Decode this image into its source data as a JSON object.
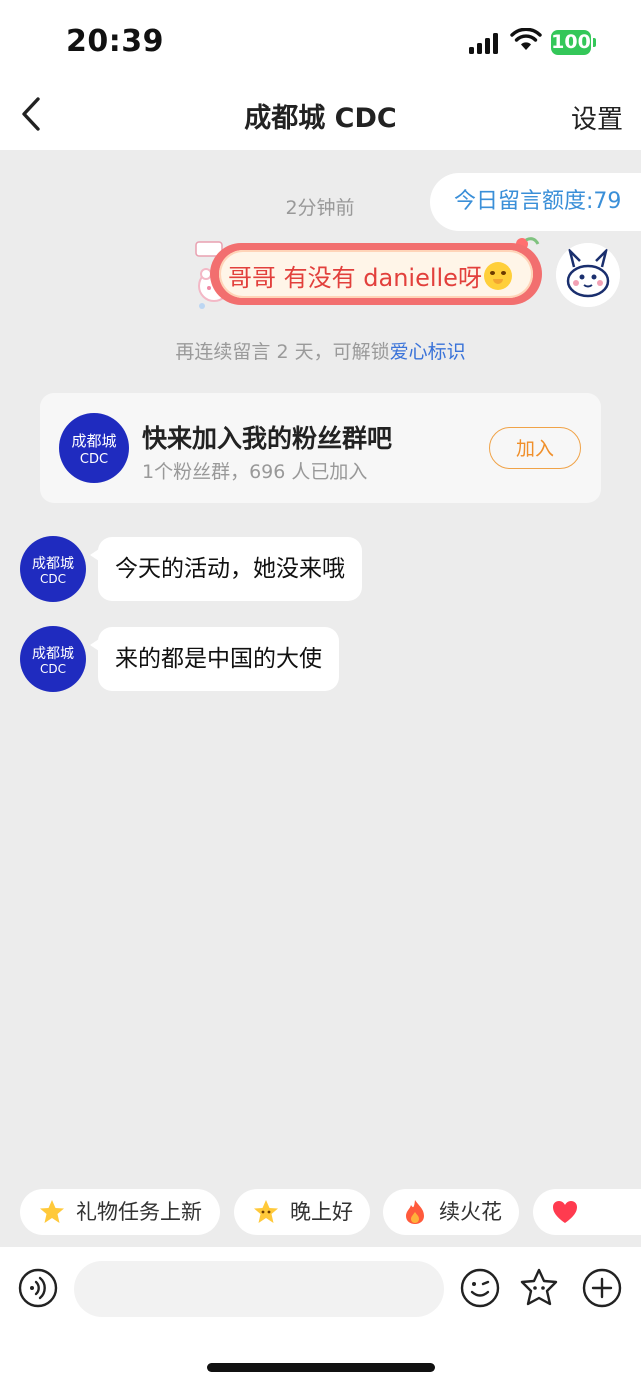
{
  "status_bar": {
    "time": "20:39",
    "battery": "100"
  },
  "nav": {
    "title": "成都城 CDC",
    "settings_label": "设置"
  },
  "chat": {
    "quota_label": "今日留言额度:79",
    "timestamp": "2分钟前",
    "my_message": "哥哥 有没有 danielle呀",
    "unlock_text": "再连续留言 2 天，可解锁",
    "unlock_link": "爱心标识",
    "fan_group": {
      "avatar_line1": "成都城",
      "avatar_line2": "CDC",
      "title": "快来加入我的粉丝群吧",
      "subtitle": "1个粉丝群，696 人已加入",
      "join_label": "加入"
    },
    "messages": [
      {
        "text": "今天的活动，她没来哦"
      },
      {
        "text": "来的都是中国的大使"
      }
    ]
  },
  "quick_replies": [
    {
      "label": "礼物任务上新",
      "icon": "star-icon"
    },
    {
      "label": "晚上好",
      "icon": "star-face-icon"
    },
    {
      "label": "续火花",
      "icon": "fire-icon"
    },
    {
      "label": "",
      "icon": "heart-icon"
    }
  ],
  "input": {
    "placeholder": ""
  },
  "colors": {
    "accent_blue": "#3a8fd8",
    "brand_blue": "#1f2bbf",
    "join_orange": "#f08f2a",
    "bubble_red": "#e2403c"
  }
}
